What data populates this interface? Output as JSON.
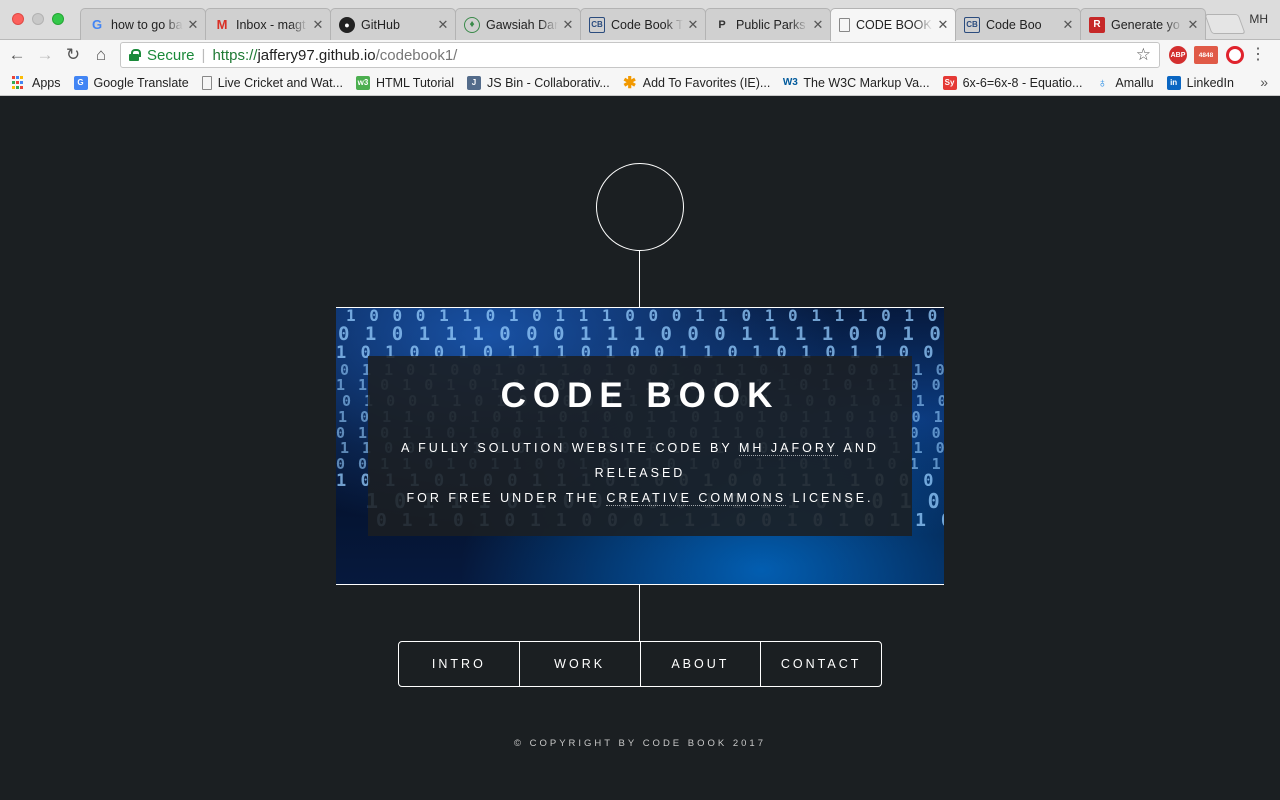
{
  "browser": {
    "tabs": [
      {
        "title": "how to go ba",
        "favicon": "google-icon"
      },
      {
        "title": "Inbox - magt",
        "favicon": "gmail-icon"
      },
      {
        "title": "GitHub",
        "favicon": "github-icon"
      },
      {
        "title": "Gawsiah Dar",
        "favicon": "mosque-icon"
      },
      {
        "title": "Code Book T",
        "favicon": "codebook-icon"
      },
      {
        "title": "Public Parks",
        "favicon": "parks-icon"
      },
      {
        "title": "CODE BOOK",
        "favicon": "document-icon"
      },
      {
        "title": "Code Boo",
        "favicon": "codebook-icon"
      },
      {
        "title": "Generate yo",
        "favicon": "r-icon"
      }
    ],
    "active_tab": 6,
    "profile": "MH",
    "address": {
      "secure_label": "Secure",
      "url_scheme": "https://",
      "url_host": "jaffery97.github.io",
      "url_path": "/codebook1/"
    },
    "extensions": {
      "adblock": "ABP",
      "mail_count": "4848"
    },
    "bookmarks": [
      {
        "label": "Apps",
        "icon": "apps-icon"
      },
      {
        "label": "Google Translate",
        "icon": "translate-icon"
      },
      {
        "label": "Live Cricket and Wat...",
        "icon": "page-icon"
      },
      {
        "label": "HTML Tutorial",
        "icon": "w3schools-icon"
      },
      {
        "label": "JS Bin - Collaborativ...",
        "icon": "jsbin-icon"
      },
      {
        "label": "Add To Favorites (IE)...",
        "icon": "star-burst-icon"
      },
      {
        "label": "The W3C Markup Va...",
        "icon": "w3c-icon"
      },
      {
        "label": "6x-6=6x-8 - Equatio...",
        "icon": "symbolab-icon"
      },
      {
        "label": "Amallu",
        "icon": "amallu-icon"
      },
      {
        "label": "LinkedIn",
        "icon": "linkedin-icon"
      }
    ]
  },
  "page": {
    "title": "CODE BOOK",
    "desc_part1": "A FULLY SOLUTION WEBSITE CODE BY ",
    "author_link": "MH JAFORY",
    "desc_part2": " AND RELEASED",
    "desc_part3": "FOR FREE UNDER THE ",
    "license_link": "CREATIVE COMMONS",
    "desc_part4": " LICENSE.",
    "nav": [
      "INTRO",
      "WORK",
      "ABOUT",
      "CONTACT"
    ],
    "copyright": "© COPYRIGHT BY CODE BOOK 2017"
  },
  "colors": {
    "page_bg": "#1b1f22",
    "text": "#ffffff",
    "secure_green": "#1a8a3a"
  }
}
